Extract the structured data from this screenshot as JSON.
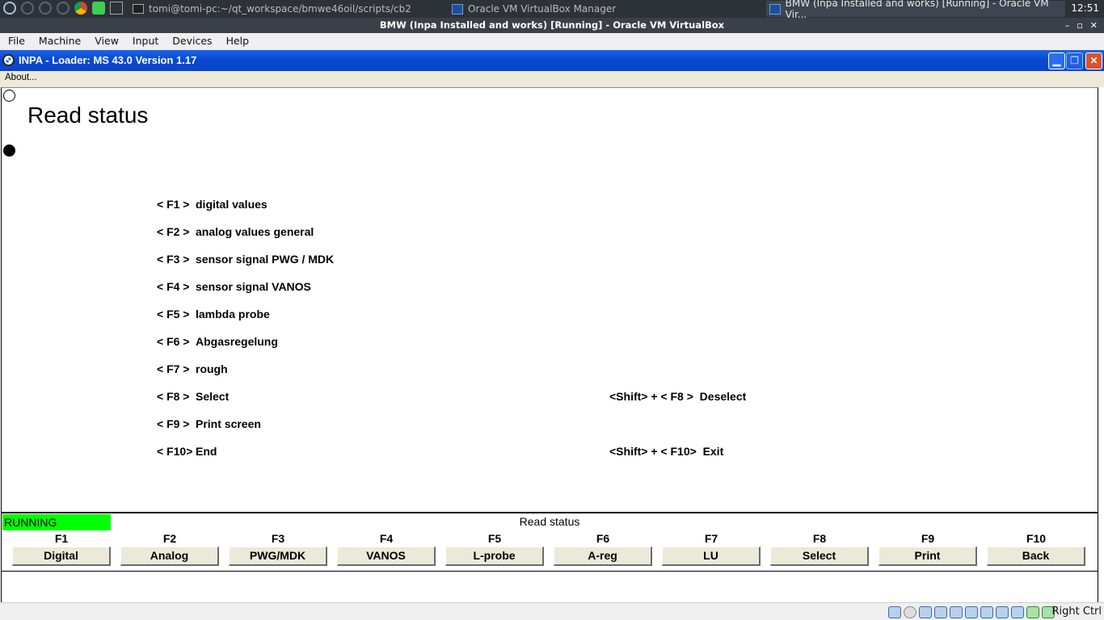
{
  "taskbar": {
    "apps": [
      {
        "icon": "terminal-icon",
        "label": "tomi@tomi-pc:~/qt_workspace/bmwe46oil/scripts/cb2"
      },
      {
        "icon": "virtualbox-icon",
        "label": "Oracle VM VirtualBox Manager"
      },
      {
        "icon": "virtualbox-icon",
        "label": "BMW (Inpa Installed and works) [Running] - Oracle VM Vir..."
      }
    ],
    "clock": "12:51"
  },
  "vbox": {
    "title": "BMW (Inpa Installed and works) [Running] - Oracle VM VirtualBox",
    "menu": [
      "File",
      "Machine",
      "View",
      "Input",
      "Devices",
      "Help"
    ],
    "host_key": "Right Ctrl"
  },
  "inpa": {
    "title": "INPA - Loader:  MS 43.0 Version 1.17",
    "menu_about": "About...",
    "heading": "Read status",
    "options_left": [
      {
        "key": "< F1 >",
        "label": "digital values"
      },
      {
        "key": "< F2 >",
        "label": "analog values general"
      },
      {
        "key": "< F3 >",
        "label": "sensor signal PWG / MDK"
      },
      {
        "key": "< F4 >",
        "label": "sensor signal VANOS"
      },
      {
        "key": "< F5 >",
        "label": "lambda probe"
      },
      {
        "key": "< F6 >",
        "label": "Abgasregelung"
      },
      {
        "key": "< F7 >",
        "label": "rough"
      },
      {
        "key": "< F8 >",
        "label": "Select"
      },
      {
        "key": "< F9 >",
        "label": "Print screen"
      },
      {
        "key": "< F10>",
        "label": "End"
      }
    ],
    "options_right": [
      {
        "key": "<Shift> + < F8 >",
        "label": "Deselect"
      },
      {
        "key": "<Shift> + < F10>",
        "label": "Exit"
      }
    ],
    "status": "RUNNING",
    "footer_title": "Read status",
    "fkeys": [
      {
        "key": "F1",
        "button": "Digital"
      },
      {
        "key": "F2",
        "button": "Analog"
      },
      {
        "key": "F3",
        "button": "PWG/MDK"
      },
      {
        "key": "F4",
        "button": "VANOS"
      },
      {
        "key": "F5",
        "button": "L-probe"
      },
      {
        "key": "F6",
        "button": "A-reg"
      },
      {
        "key": "F7",
        "button": "LU"
      },
      {
        "key": "F8",
        "button": "Select"
      },
      {
        "key": "F9",
        "button": "Print"
      },
      {
        "key": "F10",
        "button": "Back"
      }
    ]
  },
  "colors": {
    "running": "#00ff00",
    "inpa_titlebar": "#0a49cf",
    "button_face": "#ece9d8"
  }
}
